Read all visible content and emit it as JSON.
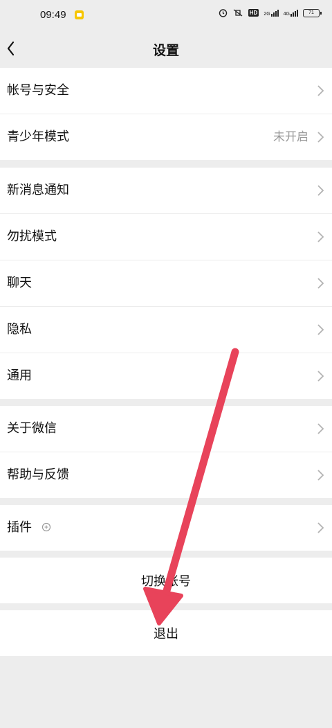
{
  "status_bar": {
    "time": "09:49",
    "network_1": "2G",
    "network_2": "4G",
    "hd": "HD",
    "battery": "71"
  },
  "nav": {
    "title": "设置"
  },
  "groups": {
    "account": [
      {
        "label": "帐号与安全",
        "value": ""
      },
      {
        "label": "青少年模式",
        "value": "未开启"
      }
    ],
    "general": [
      {
        "label": "新消息通知"
      },
      {
        "label": "勿扰模式"
      },
      {
        "label": "聊天"
      },
      {
        "label": "隐私"
      },
      {
        "label": "通用"
      }
    ],
    "about": [
      {
        "label": "关于微信"
      },
      {
        "label": "帮助与反馈"
      }
    ],
    "plugins": [
      {
        "label": "插件"
      }
    ]
  },
  "switch_account": "切换帐号",
  "logout": "退出",
  "colors": {
    "background": "#ededed",
    "arrow": "#e8435a",
    "muted_text": "#9a9a9a"
  }
}
